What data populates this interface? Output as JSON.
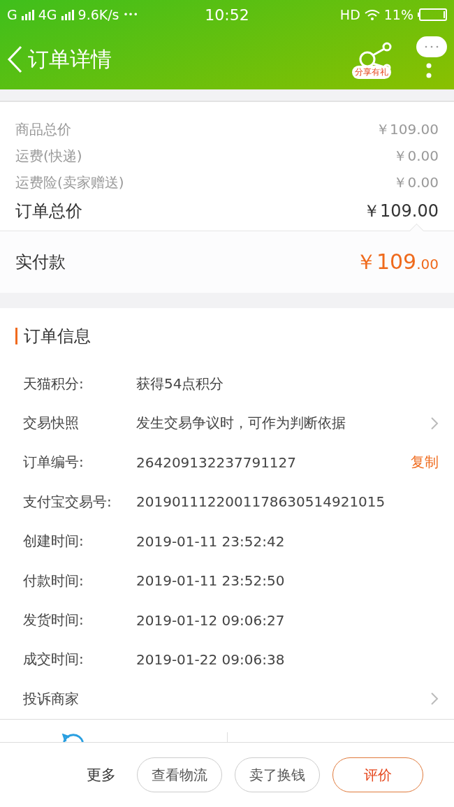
{
  "status_bar": {
    "sim1": "G",
    "sim2": "4G",
    "speed": "9.6K/s",
    "more": "•••",
    "time": "10:52",
    "hd": "HD",
    "battery": "11%"
  },
  "header": {
    "title": "订单详情",
    "share_badge": "分享有礼"
  },
  "price_lines": [
    {
      "label": "商品总价",
      "value": "￥109.00",
      "kind": "minor"
    },
    {
      "label": "运费(快递)",
      "value": "￥0.00",
      "kind": "minor"
    },
    {
      "label": "运费险(卖家赠送)",
      "value": "￥0.00",
      "kind": "minor"
    },
    {
      "label": "订单总价",
      "value": "￥109.00",
      "kind": "total"
    }
  ],
  "paid": {
    "label": "实付款",
    "amount": "￥109.00"
  },
  "order_info": {
    "title": "订单信息",
    "rows": [
      {
        "label": "天猫积分:",
        "value": "获得54点积分",
        "kind": "plain"
      },
      {
        "label": "交易快照",
        "value": "发生交易争议时，可作为判断依据",
        "kind": "link"
      },
      {
        "label": "订单编号:",
        "value": "264209132237791127",
        "kind": "copy",
        "action": "复制"
      },
      {
        "label": "支付宝交易号:",
        "value": "2019011122001178630514921015",
        "kind": "plain"
      },
      {
        "label": "创建时间:",
        "value": "2019-01-11 23:52:42",
        "kind": "plain"
      },
      {
        "label": "付款时间:",
        "value": "2019-01-11 23:52:50",
        "kind": "plain"
      },
      {
        "label": "发货时间:",
        "value": "2019-01-12 09:06:27",
        "kind": "plain"
      },
      {
        "label": "成交时间:",
        "value": "2019-01-22 09:06:38",
        "kind": "plain"
      },
      {
        "label": "投诉商家",
        "kind": "link"
      }
    ]
  },
  "bottom_bar": {
    "more": "更多",
    "buttons": [
      {
        "label": "查看物流",
        "kind": "normal"
      },
      {
        "label": "卖了换钱",
        "kind": "normal"
      },
      {
        "label": "评价",
        "kind": "primary"
      }
    ]
  }
}
